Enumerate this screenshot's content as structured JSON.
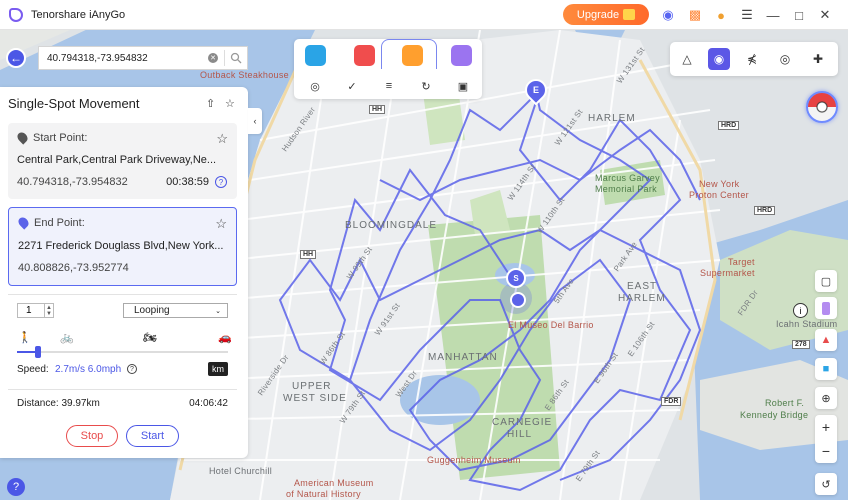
{
  "app": {
    "title": "Tenorshare iAnyGo",
    "upgrade_label": "Upgrade"
  },
  "search": {
    "value": "40.794318,-73.954832"
  },
  "panel": {
    "title": "Single-Spot Movement",
    "start": {
      "label": "Start Point:",
      "address": "Central Park,Central Park Driveway,Ne...",
      "coords": "40.794318,-73.954832",
      "time": "00:38:59"
    },
    "end": {
      "label": "End Point:",
      "address": "2271 Frederick Douglass Blvd,New York...",
      "coords": "40.808826,-73.952774"
    },
    "repeat_count": "1",
    "loop_mode": "Looping",
    "speed_label": "Speed:",
    "speed_value": "2.7m/s 6.0mph",
    "speed_fraction": 0.1,
    "unit_toggle": "km",
    "distance_label": "Distance: 39.97km",
    "duration": "04:06:42",
    "stop_label": "Stop",
    "start_label": "Start"
  },
  "markers": {
    "end": "E",
    "start": "S"
  },
  "map_labels": [
    {
      "text": "HARLEM",
      "cls": "big"
    },
    {
      "text": "BLOOMINGDALE",
      "cls": "big"
    },
    {
      "text": "MANHATTAN",
      "cls": "big"
    },
    {
      "text": "UPPER",
      "cls": "big"
    },
    {
      "text": "WEST SIDE",
      "cls": "big"
    },
    {
      "text": "CARNEGIE",
      "cls": "big"
    },
    {
      "text": "HILL",
      "cls": "big"
    },
    {
      "text": "EAST",
      "cls": "big"
    },
    {
      "text": "HARLEM",
      "cls": "big"
    },
    {
      "text": "Marcus Garvey",
      "cls": "green"
    },
    {
      "text": "Memorial Park",
      "cls": "green"
    },
    {
      "text": "New York",
      "cls": "red"
    },
    {
      "text": "Proton Center",
      "cls": "red"
    },
    {
      "text": "Target",
      "cls": "red"
    },
    {
      "text": "Supermarket",
      "cls": "red"
    },
    {
      "text": "El Museo Del Barrio",
      "cls": "red"
    },
    {
      "text": "Guggenheim Museum",
      "cls": "red"
    },
    {
      "text": "Hotel Churchill",
      "cls": ""
    },
    {
      "text": "American Museum",
      "cls": "red"
    },
    {
      "text": "of Natural History",
      "cls": "red"
    },
    {
      "text": "Outback Steakhouse",
      "cls": "red"
    },
    {
      "text": "Robert F.",
      "cls": "green"
    },
    {
      "text": "Kennedy Bridge",
      "cls": "green"
    },
    {
      "text": "Icahn Stadium",
      "cls": ""
    },
    {
      "text": "W 131st St",
      "cls": "road"
    },
    {
      "text": "W 121st St",
      "cls": "road"
    },
    {
      "text": "W 114th St",
      "cls": "road"
    },
    {
      "text": "W 110th St",
      "cls": "road"
    },
    {
      "text": "W 99th St",
      "cls": "road"
    },
    {
      "text": "W 91st St",
      "cls": "road"
    },
    {
      "text": "W 86th St",
      "cls": "road"
    },
    {
      "text": "W 79th St",
      "cls": "road"
    },
    {
      "text": "E 106th St",
      "cls": "road"
    },
    {
      "text": "E 96th St",
      "cls": "road"
    },
    {
      "text": "E 86th St",
      "cls": "road"
    },
    {
      "text": "E 79th St",
      "cls": "road"
    },
    {
      "text": "Park Ave",
      "cls": "road"
    },
    {
      "text": "5th Ave",
      "cls": "road"
    },
    {
      "text": "West Dr",
      "cls": "road"
    },
    {
      "text": "Riverside Dr",
      "cls": "road"
    },
    {
      "text": "Hudson River",
      "cls": "road"
    },
    {
      "text": "FDR Dr",
      "cls": "road"
    }
  ],
  "highway_shields": [
    "HRD",
    "HRD",
    "HH",
    "HH",
    "FDR",
    "278"
  ],
  "icons": {
    "discord": "discord-icon",
    "gift": "gift-icon",
    "user": "user-icon",
    "menu": "menu-icon",
    "minimize": "minimize-icon",
    "maximize": "maximize-icon",
    "close": "close-icon"
  },
  "colors": {
    "accent": "#4b57e6",
    "route": "#5b63e9",
    "upgrade": "#ff7a33",
    "stop": "#e84c4c"
  }
}
